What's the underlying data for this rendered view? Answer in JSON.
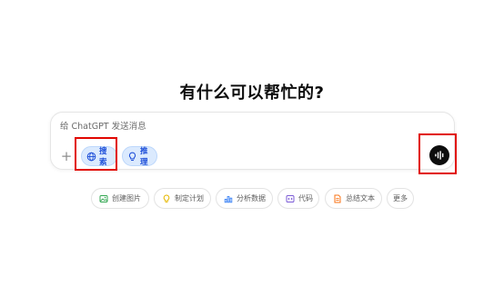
{
  "headline": "有什么可以帮忙的?",
  "composer": {
    "placeholder": "给 ChatGPT 发送消息",
    "value": "",
    "plus_glyph": "+",
    "search_label": "搜索",
    "reason_label": "推理"
  },
  "chips": [
    {
      "label": "创建图片",
      "icon": "image-icon",
      "color": "#34a853"
    },
    {
      "label": "制定计划",
      "icon": "lightbulb-icon",
      "color": "#e6b800"
    },
    {
      "label": "分析数据",
      "icon": "chart-icon",
      "color": "#3b82f6"
    },
    {
      "label": "代码",
      "icon": "code-icon",
      "color": "#7c5cd6"
    },
    {
      "label": "总结文本",
      "icon": "document-icon",
      "color": "#f97316"
    },
    {
      "label": "更多",
      "icon": "",
      "color": ""
    }
  ],
  "colors": {
    "accent": "#1d4ed8",
    "accent_bg": "#dbeafe",
    "highlight": "#e10600",
    "voice_button": "#0d0d0d"
  }
}
